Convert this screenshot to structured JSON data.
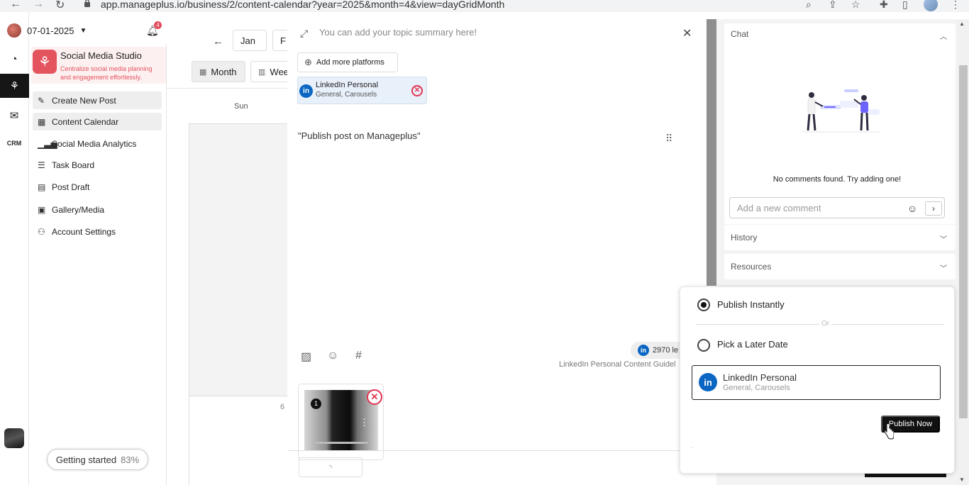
{
  "browser": {
    "url": "app.manageplus.io/business/2/content-calendar?year=2025&month=4&view=dayGridMonth"
  },
  "topbar": {
    "date": "07-01-2025",
    "notification_count": "4"
  },
  "studio": {
    "title": "Social Media Studio",
    "description": "Centralize social media planning and engagement effortlessly."
  },
  "sidebar": {
    "items": [
      {
        "label": "Create New Post",
        "icon": "create-post-icon"
      },
      {
        "label": "Content Calendar",
        "icon": "calendar-icon"
      },
      {
        "label": "Social Media Analytics",
        "icon": "analytics-icon"
      },
      {
        "label": "Task Board",
        "icon": "task-board-icon"
      },
      {
        "label": "Post Draft",
        "icon": "draft-icon"
      },
      {
        "label": "Gallery/Media",
        "icon": "gallery-icon"
      },
      {
        "label": "Account Settings",
        "icon": "user-icon"
      }
    ]
  },
  "getting_started": {
    "label": "Getting started",
    "percent": "83%",
    "progress": 0.83
  },
  "calendar": {
    "prev_month": "Jan",
    "next_month_partial": "F",
    "view_month": "Month",
    "view_week_partial": "Wee",
    "weekday": "Sun",
    "day_number": "6"
  },
  "editor": {
    "topic_placeholder": "You can add your topic summary here!",
    "add_platforms": "Add more platforms",
    "platform_name": "LinkedIn Personal",
    "platform_sub": "General, Carousels",
    "post_text": "\"Publish post on Manageplus\"",
    "char_count_partial": "2970 le",
    "guidelines_partial": "LinkedIn Personal Content Guidel",
    "media_index": "1"
  },
  "chat": {
    "title": "Chat",
    "empty_text": "No comments found. Try adding one!",
    "comment_placeholder": "Add a new comment"
  },
  "accordions": {
    "history": "History",
    "resources": "Resources"
  },
  "publish": {
    "option_instant": "Publish Instantly",
    "or": "Or",
    "option_later": "Pick a Later Date",
    "account_name": "LinkedIn Personal",
    "account_sub": "General, Carousels",
    "button": "Publish Now"
  },
  "colors": {
    "brand": "#e4545f",
    "linkedin": "#0a66c2",
    "danger": "#e2334f"
  }
}
